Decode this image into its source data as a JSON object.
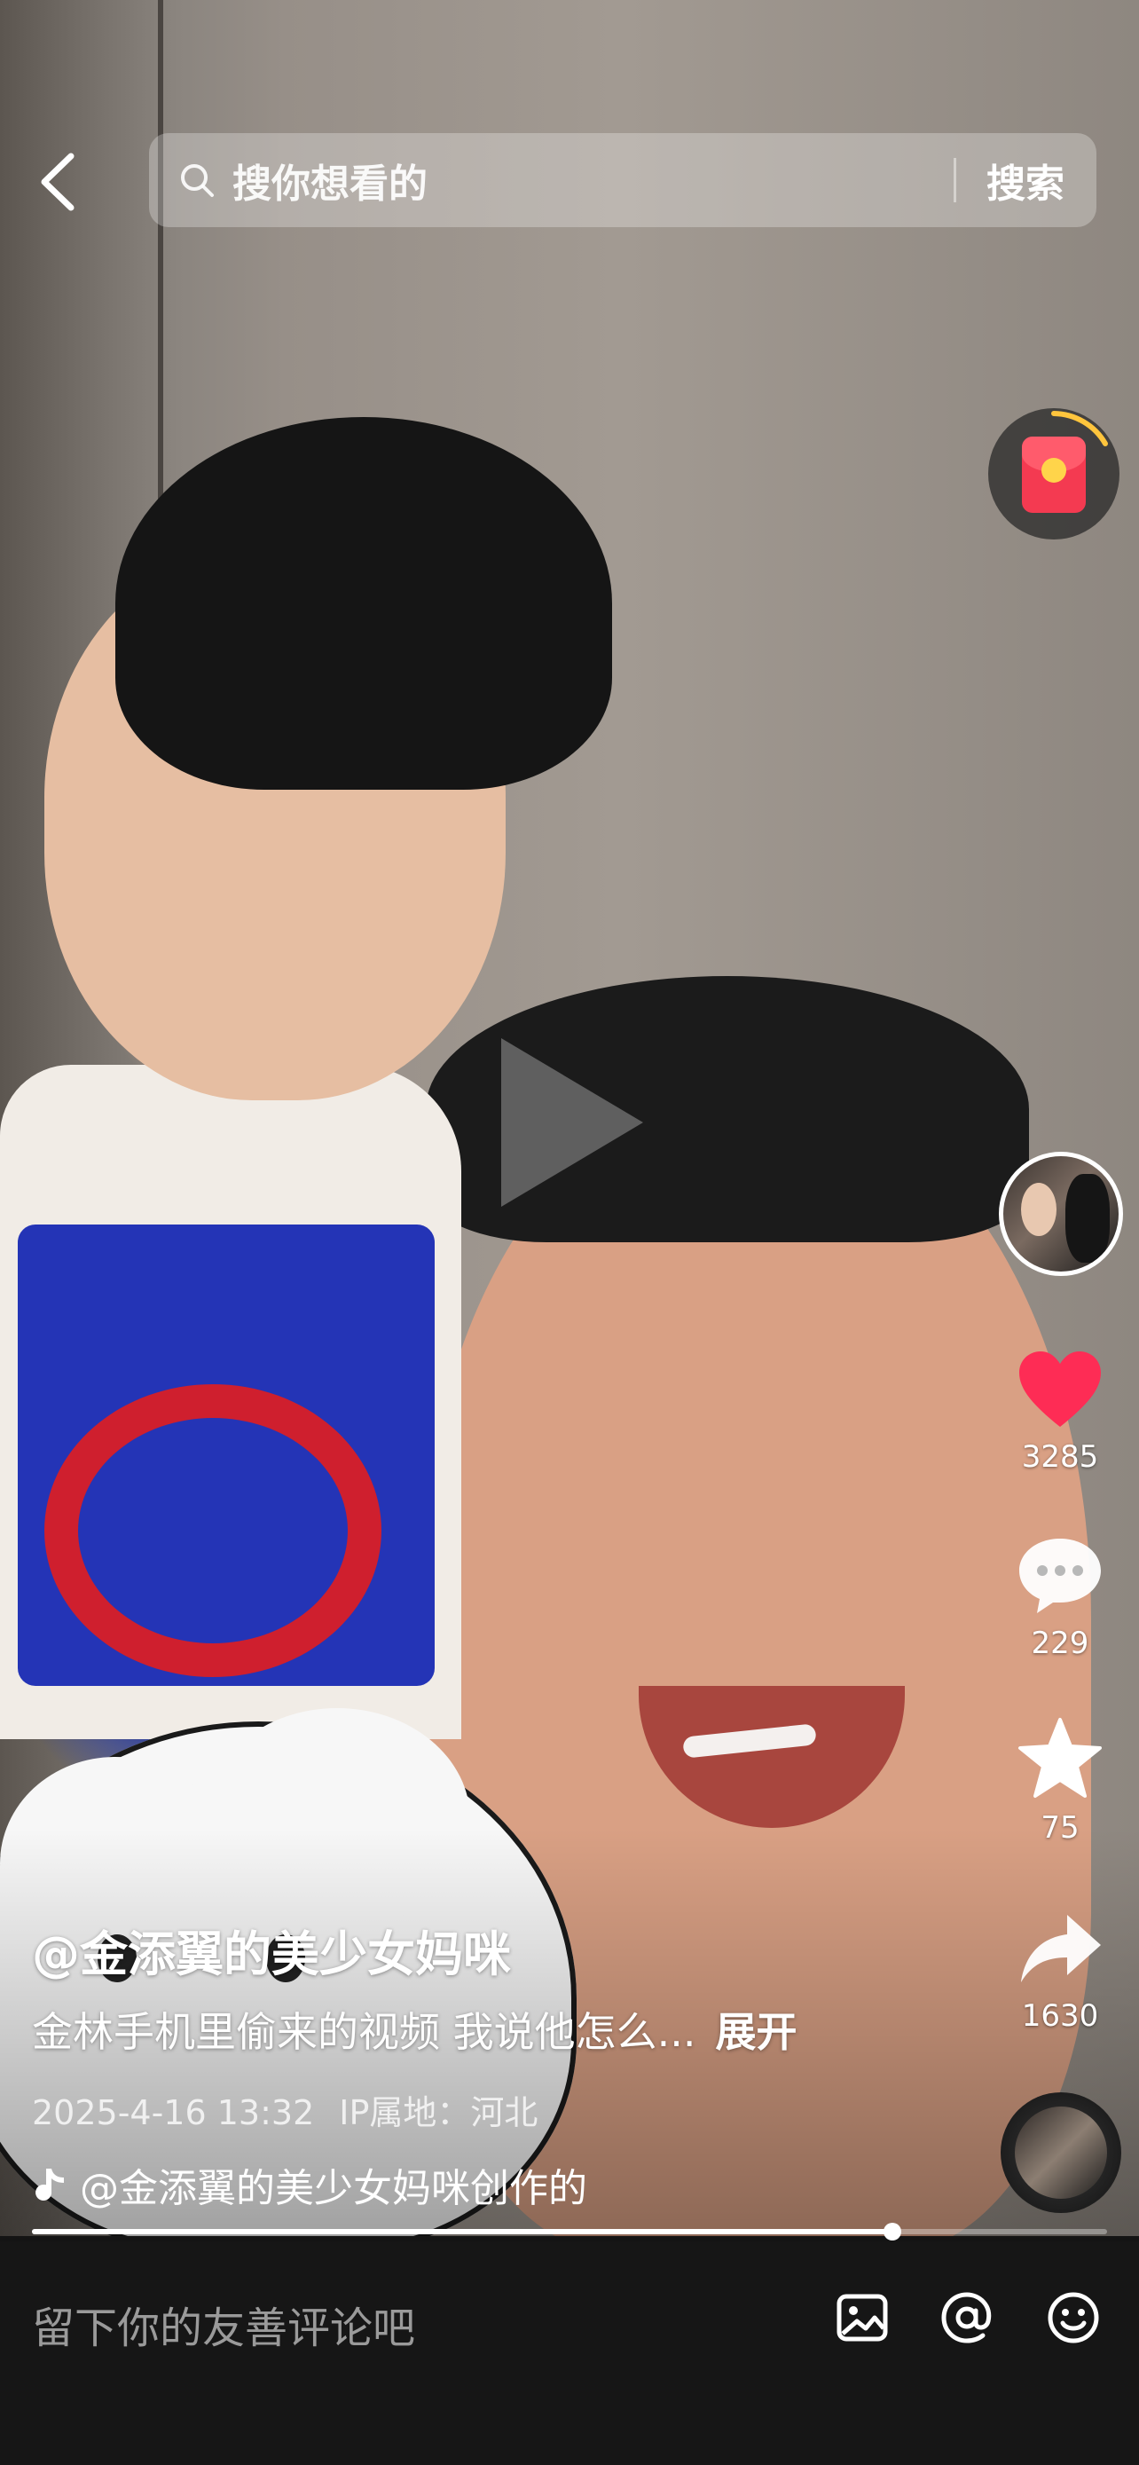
{
  "search": {
    "placeholder": "搜你想看的",
    "button_label": "搜索"
  },
  "actions": {
    "like_count": "3285",
    "comment_count": "229",
    "favorite_count": "75",
    "share_count": "1630"
  },
  "post": {
    "author": "@金添翼的美少女妈咪",
    "caption": "金林手机里偷来的视频 我说他怎么...",
    "expand_label": "展开",
    "datetime": "2025-4-16 13:32",
    "ip_location": "IP属地：河北",
    "music_text": "@金添翼的美少女妈咪创作的"
  },
  "progress": {
    "fraction": 0.8
  },
  "comment_bar": {
    "placeholder": "留下你的友善评论吧"
  },
  "colors": {
    "like": "#fe2c55",
    "redpacket": "#f43a51",
    "comment_bar_bg": "#161616"
  }
}
